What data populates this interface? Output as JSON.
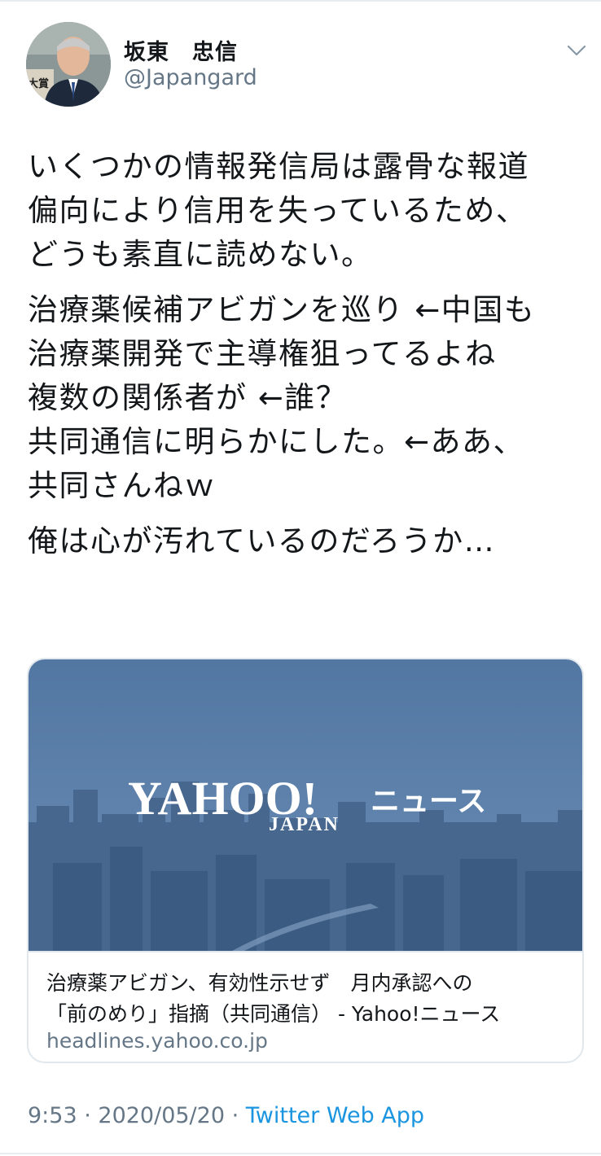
{
  "author": {
    "name": "坂東　忠信",
    "handle": "@Japangard",
    "avatar_badge": "大賞"
  },
  "tweet": {
    "paragraphs": [
      [
        "いくつかの情報発信局は露骨な報道",
        "偏向により信用を失っているため、",
        "どうも素直に読めない。"
      ],
      [
        "治療薬候補アビガンを巡り ←中国も",
        "治療薬開発で主導権狙ってるよね",
        "複数の関係者が ←誰？",
        "共同通信に明らかにした。←ああ、",
        "共同さんねｗ"
      ],
      [
        "俺は心が汚れているのだろうか…"
      ]
    ]
  },
  "card": {
    "logo_main": "YAHOO!",
    "logo_sub": "JAPAN",
    "logo_suffix": "ニュース",
    "title_line1": "治療薬アビガン、有効性示せず　月内承認への",
    "title_line2": "「前のめり」指摘（共同通信） - Yahoo!ニュース",
    "domain": "headlines.yahoo.co.jp"
  },
  "meta": {
    "time": "9:53",
    "separator": " · ",
    "date": "2020/05/20",
    "source": "Twitter Web App"
  },
  "icons": {
    "caret": "chevron-down-icon"
  },
  "colors": {
    "text": "#14171a",
    "secondary": "#657786",
    "link": "#1b95e0",
    "card_sky": "#5b7fa8",
    "card_city": "#3f5f86"
  }
}
